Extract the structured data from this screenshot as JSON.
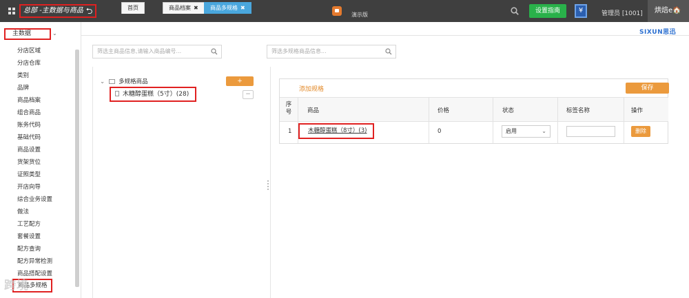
{
  "topbar": {
    "brand_title": "总部 -主数据与商品",
    "demo_label": "演示版",
    "guide_button": "设置指南",
    "yen_symbol": "¥",
    "admin_label": "管理员 [1001]",
    "store_label": "烘焙e🏠"
  },
  "sidebar": {
    "section_label": "主数据",
    "items": [
      "分店区域",
      "分店仓库",
      "类别",
      "品牌",
      "商品档案",
      "组合商品",
      "账务代码",
      "基础代码",
      "商品设置",
      "货架货位",
      "证照类型",
      "开店向导",
      "综合业务设置",
      "做法",
      "工艺配方",
      "套餐设置",
      "配方查询",
      "配方异常检测",
      "商品搭配设置"
    ],
    "active_item": "商品多规格",
    "watermark": "跨境"
  },
  "tabs": [
    {
      "label": "首页",
      "closable": false
    },
    {
      "label": "商品档案",
      "closable": true
    },
    {
      "label": "商品多规格",
      "closable": true
    }
  ],
  "tab_close_symbol": "✖",
  "logo_text": "SIXUN思迅",
  "left_panel": {
    "search_placeholder": "筛选主商品信息,请输入商品编号...",
    "tree_root_label": "多规格商品",
    "tree_item_label": "木糖醇蛋糕（5寸）(28)",
    "add_button": "+",
    "remove_button": "−"
  },
  "right_panel": {
    "search_placeholder": "筛选多规格商品信息...",
    "add_spec_label": "添加规格",
    "save_button": "保存",
    "table": {
      "headers": {
        "index": "序号",
        "product": "商品",
        "price": "价格",
        "status": "状态",
        "tag_name": "标签名称",
        "action": "操作"
      },
      "rows": [
        {
          "index": "1",
          "product": "木糖醇蛋糕（8寸）(3)",
          "price": "0",
          "status": "启用",
          "tag_name": "",
          "action": "删除"
        }
      ]
    }
  },
  "colors": {
    "accent_orange": "#eb9a3d",
    "topbar": "#3f3f3f",
    "guide_green": "#29b14a",
    "tab_blue": "#4aa7dd",
    "highlight_red": "#e02020"
  }
}
